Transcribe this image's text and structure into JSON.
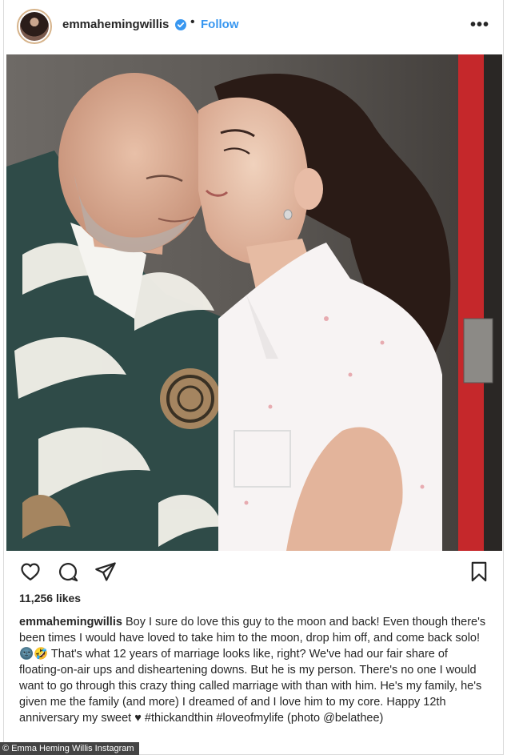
{
  "post": {
    "username": "emmahemingwillis",
    "follow_label": "Follow",
    "separator": "•",
    "more_label": "•••",
    "likes": "11,256 likes",
    "caption_user": "emmahemingwillis",
    "caption_text": "Boy I sure do love this guy to the moon and back! Even though there's been times I would have loved to take him to the moon, drop him off, and come back solo! 🌚🤣 That's what 12 years of marriage looks like, right? We've had our fair share of floating-on-air ups and disheartening downs. But he is my person. There's no one I would want to go through this crazy thing called marriage with than with him. He's my family, he's given me the family (and more) I dreamed of and I love him to my core. Happy 12th anniversary my sweet ♥ #thickandthin #loveofmylife (photo @belathee)"
  },
  "credit": "© Emma Heming Willis Instagram",
  "colors": {
    "link_blue": "#3897f0",
    "text": "#262626",
    "door_red": "#c5282b"
  },
  "icons": [
    "verified-badge-icon",
    "heart-icon",
    "comment-icon",
    "share-icon",
    "bookmark-icon",
    "more-options-icon"
  ]
}
